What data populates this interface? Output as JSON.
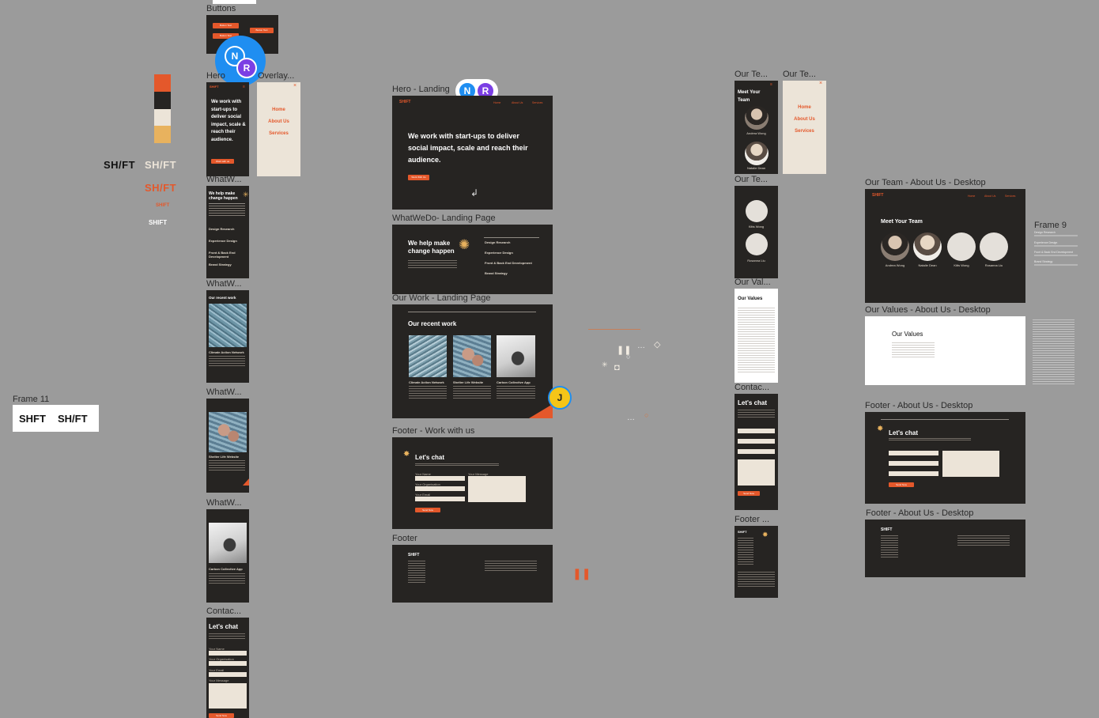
{
  "canvas": {
    "bg": "#9b9b9b",
    "colors": {
      "orange": "#e4582b",
      "dark": "#262422",
      "cream": "#ece4d8",
      "gold": "#e8b25e",
      "collab_blue": "#1f8ef1",
      "collab_purple": "#7b3fe4",
      "collab_yellow": "#f5c518"
    }
  },
  "frame_labels": {
    "buttons": "Buttons",
    "hero_mobile": "Hero",
    "overlay": "Overlay...",
    "whatwedo_m1": "WhatW...",
    "whatwedo_m2": "WhatW...",
    "whatwedo_m3": "WhatW...",
    "whatwedo_m4": "WhatW...",
    "contact_m": "Contac...",
    "frame11": "Frame 11",
    "hero_landing": "Hero - Landing",
    "whatwedo_landing": "WhatWeDo- Landing Page",
    "ourwork_landing": "Our Work - Landing Page",
    "footer_work": "Footer - Work with us",
    "footer": "Footer",
    "ourteam_m1": "Our Te...",
    "ourteam_m2": "Our Te...",
    "ourteam_m3": "Our Te...",
    "ourvalues_m": "Our Val...",
    "contact_m2": "Contac...",
    "footer_m": "Footer ...",
    "ourteam_desktop": "Our Team - About Us - Desktop",
    "frame9": "Frame 9",
    "ourvalues_desktop": "Our Values - About Us - Desktop",
    "footer_about1": "Footer - About Us - Desktop",
    "footer_about2": "Footer - About Us - Desktop"
  },
  "brand": {
    "logo": "SHIFT",
    "logo_styled": "SH/FT",
    "frame11_logo_a": "SHFT",
    "frame11_logo_b": "SH/FT"
  },
  "buttons_frame": {
    "btn1": "Button Text",
    "btn2": "Button Text",
    "btn3": "Button Text"
  },
  "collaborators": {
    "n": "N",
    "r": "R",
    "j": "J"
  },
  "hero_mobile": {
    "headline": "We work with start-ups to deliver social impact, scale & reach their audience.",
    "cta": "Work with us"
  },
  "overlay_menu": {
    "home": "Home",
    "about": "About Us",
    "services": "Services",
    "close": "×"
  },
  "whatwedo_mobile": {
    "headline": "We help make change happen",
    "items": [
      "Design Research",
      "Experience Design",
      "Front & Back End Development",
      "Brand Strategy"
    ]
  },
  "ourwork_mobile": {
    "title": "Our recent work",
    "caption1": "Climate Action Network",
    "caption2": "Shelter Life Website",
    "caption3": "Carbon Collective App"
  },
  "contact_mobile": {
    "title": "Let's chat",
    "labels": [
      "Your Name",
      "Your Organisation",
      "Your Email",
      "Your Message"
    ],
    "send": "Send Now"
  },
  "hero_landing": {
    "nav": [
      "Home",
      "About Us",
      "Services"
    ],
    "headline": "We work with start-ups to deliver social impact, scale and reach their audience.",
    "cta": "Work With Us"
  },
  "whatwedo_landing": {
    "headline": "We help make change happen",
    "items": [
      "Design Research",
      "Experience Design",
      "Front & Back End Development",
      "Brand Strategy"
    ]
  },
  "ourwork_landing": {
    "title": "Our recent work",
    "captions": [
      "Climate Action Network",
      "Shelter Life Website",
      "Carbon Collective App"
    ]
  },
  "footer_work": {
    "title": "Let's chat",
    "labels": [
      "Your Name",
      "Your Organisation",
      "Your Email",
      "Your Message"
    ],
    "send": "Send Now"
  },
  "ourteam_mobile": {
    "title": "Meet Your Team",
    "names": [
      "Andrea Wong",
      "Natalie Dean",
      "Kitts Wong",
      "Rosanna Liu"
    ]
  },
  "ourteam_desktop": {
    "title": "Meet Your Team",
    "nav": [
      "Home",
      "About Us",
      "Services"
    ],
    "names": [
      "Andrea Wong",
      "Natalie Dean",
      "Kitts Wong",
      "Rosanna Liu"
    ]
  },
  "frame9": {
    "items": [
      "Design Research",
      "Experience Design",
      "Front & Back End Development",
      "Brand Strategy"
    ]
  },
  "ourvalues": {
    "title": "Our Values"
  },
  "footer_about": {
    "title": "Let's chat",
    "send": "Send Now"
  }
}
